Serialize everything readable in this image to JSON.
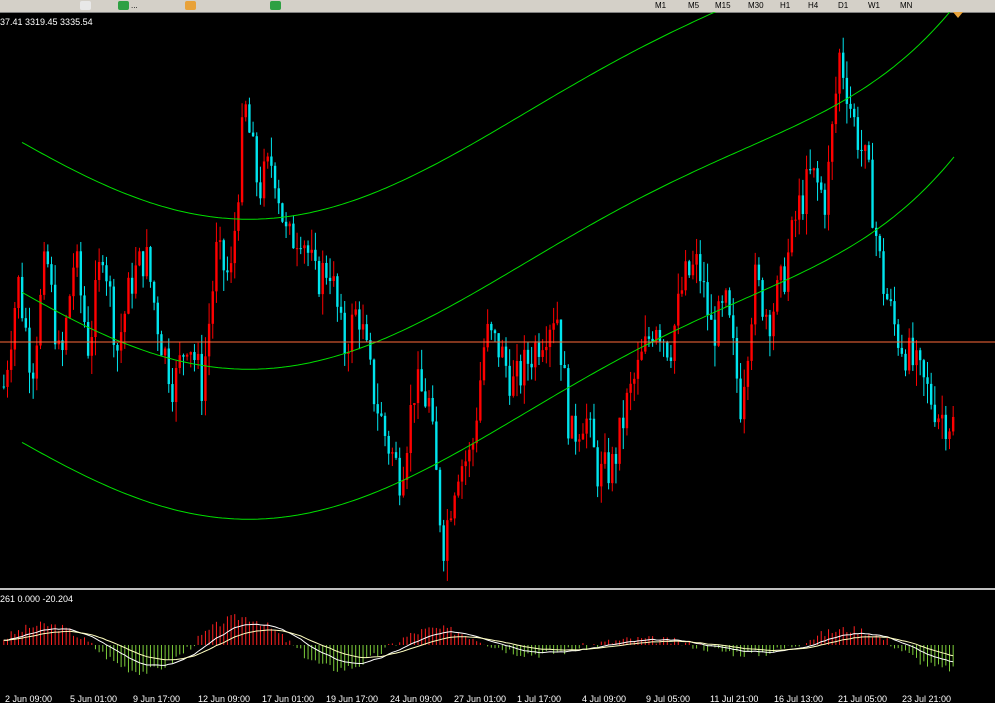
{
  "toolbar": {
    "buttons": [
      {
        "id": "zoom-out",
        "icon": "magnifier-minus-icon",
        "label": ""
      },
      {
        "id": "new-order",
        "icon": "plus-green-icon",
        "label": "..."
      },
      {
        "id": "expert",
        "icon": "diamond-icon",
        "label": ""
      },
      {
        "id": "autotrading",
        "icon": "play-green-icon",
        "label": ""
      },
      {
        "id": "tf-m1",
        "label": "M1"
      },
      {
        "id": "tf-m5",
        "label": "M5"
      },
      {
        "id": "tf-m15",
        "label": "M15"
      },
      {
        "id": "tf-m30",
        "label": "M30"
      },
      {
        "id": "tf-h1",
        "label": "H1"
      },
      {
        "id": "tf-h4",
        "label": "H4"
      },
      {
        "id": "tf-d1",
        "label": "D1"
      },
      {
        "id": "tf-w1",
        "label": "W1"
      },
      {
        "id": "tf-mn",
        "label": "MN"
      }
    ],
    "selected_timeframe": "H4"
  },
  "chart": {
    "ohlc_text": "37.41 3319.45 3335.54",
    "colors": {
      "background": "#000000",
      "bull": "#ff0000",
      "bear": "#00e5ee",
      "channel": "#00e000",
      "price_line": "#ff6a3a"
    }
  },
  "macd": {
    "label": "261 0.000 -20.204",
    "colors": {
      "hist_up": "#ff2020",
      "hist_down": "#7ccd3a",
      "signal": "#ffffc0",
      "line": "#ffffff"
    }
  },
  "chart_data": {
    "type": "candlestick",
    "x_labels": [
      "2 Jun 09:00",
      "5 Jun 01:00",
      "9 Jun 17:00",
      "12 Jun 09:00",
      "17 Jun 01:00",
      "19 Jun 17:00",
      "24 Jun 09:00",
      "27 Jun 01:00",
      "1 Jul 17:00",
      "4 Jul 09:00",
      "9 Jul 05:00",
      "11 Jul 21:00",
      "16 Jul 13:00",
      "21 Jul 05:00",
      "23 Jul 21:00"
    ],
    "close_path": [
      0.35,
      0.55,
      0.38,
      0.6,
      0.38,
      0.6,
      0.42,
      0.62,
      0.42,
      0.55,
      0.6,
      0.45,
      0.35,
      0.45,
      0.35,
      0.6,
      0.55,
      0.88,
      0.72,
      0.78,
      0.62,
      0.65,
      0.55,
      0.58,
      0.42,
      0.5,
      0.35,
      0.25,
      0.18,
      0.35,
      0.32,
      0.05,
      0.2,
      0.22,
      0.45,
      0.42,
      0.35,
      0.4,
      0.45,
      0.5,
      0.25,
      0.3,
      0.18,
      0.2,
      0.32,
      0.4,
      0.48,
      0.42,
      0.55,
      0.58,
      0.45,
      0.5,
      0.32,
      0.55,
      0.48,
      0.55,
      0.68,
      0.75,
      0.7,
      0.98,
      0.85,
      0.75,
      0.55,
      0.45,
      0.4,
      0.35,
      0.3,
      0.28
    ]
  }
}
